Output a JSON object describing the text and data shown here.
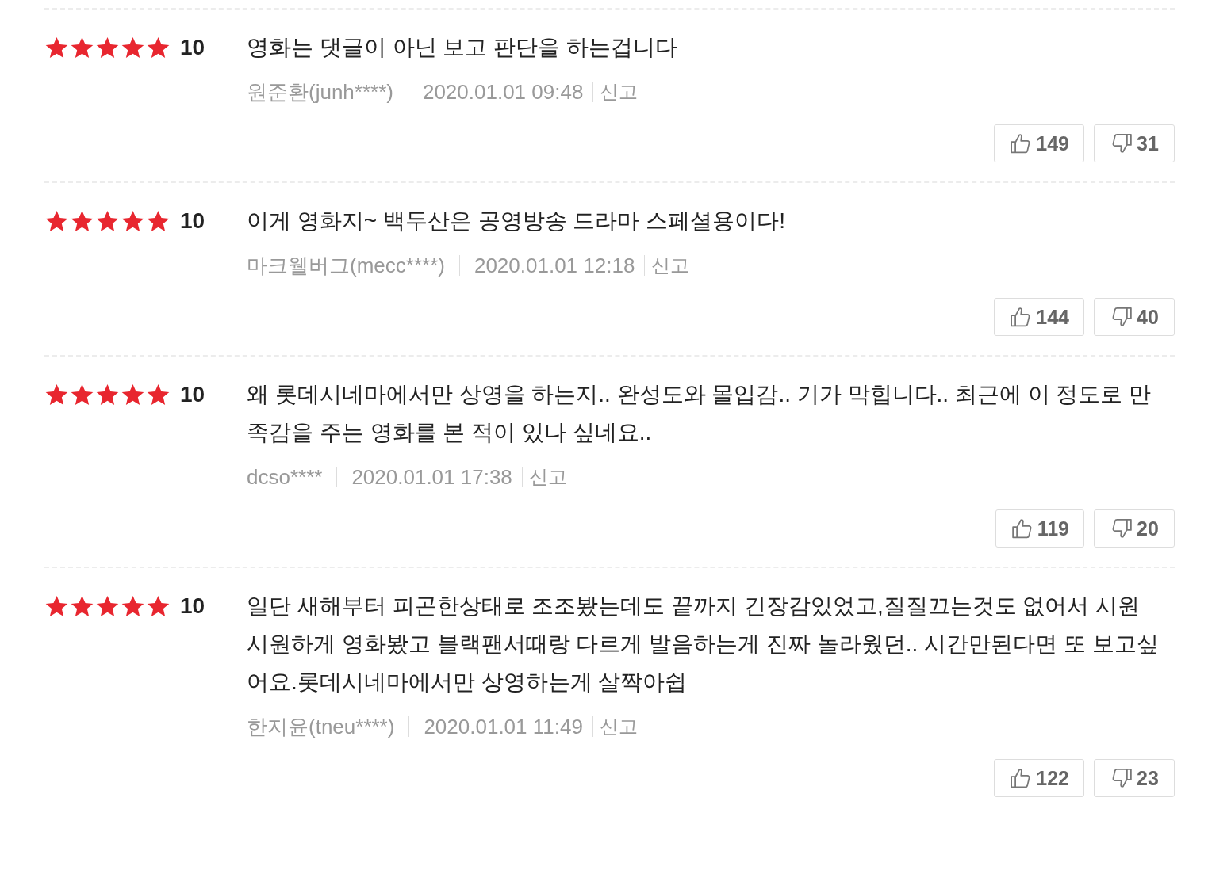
{
  "reviews": [
    {
      "stars": 5,
      "score": "10",
      "text": "영화는 댓글이 아닌 보고 판단을 하는겁니다",
      "author": "원준환(junh****)",
      "date": "2020.01.01 09:48",
      "report": "신고",
      "likes": "149",
      "dislikes": "31"
    },
    {
      "stars": 5,
      "score": "10",
      "text": "이게 영화지~ 백두산은 공영방송 드라마 스페셜용이다!",
      "author": "마크웰버그(mecc****)",
      "date": "2020.01.01 12:18",
      "report": "신고",
      "likes": "144",
      "dislikes": "40"
    },
    {
      "stars": 5,
      "score": "10",
      "text": "왜 롯데시네마에서만 상영을 하는지.. 완성도와 몰입감.. 기가 막힙니다.. 최근에 이 정도로 만족감을 주는 영화를 본 적이 있나 싶네요..",
      "author": "dcso****",
      "date": "2020.01.01 17:38",
      "report": "신고",
      "likes": "119",
      "dislikes": "20"
    },
    {
      "stars": 5,
      "score": "10",
      "text": "일단 새해부터 피곤한상태로 조조봤는데도 끝까지 긴장감있었고,질질끄는것도 없어서 시원시원하게 영화봤고 블랙팬서때랑 다르게 발음하는게 진짜 놀라웠던.. 시간만된다면 또 보고싶어요.롯데시네마에서만 상영하는게 살짝아쉽",
      "author": "한지윤(tneu****)",
      "date": "2020.01.01 11:49",
      "report": "신고",
      "likes": "122",
      "dislikes": "23"
    }
  ]
}
